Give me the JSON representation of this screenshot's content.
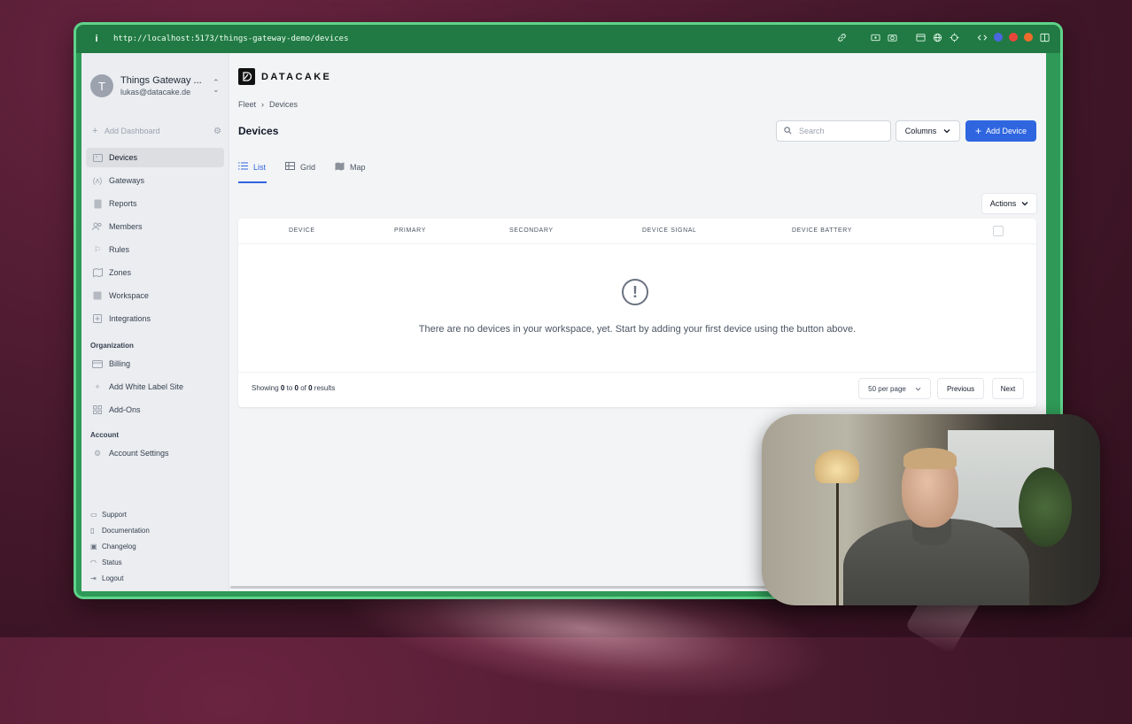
{
  "browser": {
    "info_icon": "i",
    "url": "http://localhost:5173/things-gateway-demo/devices",
    "toolbar_icons": [
      "link-icon",
      "screen-icon",
      "camera-icon",
      "window-icon",
      "globe-icon",
      "target-icon",
      "code-icon",
      "blue-extension-icon",
      "red-extension-icon",
      "orange-extension-icon",
      "sidebar-icon"
    ]
  },
  "sidebar": {
    "account": {
      "avatar_letter": "T",
      "name": "Things Gateway ...",
      "email": "lukas@datacake.de"
    },
    "add_dashboard": "Add Dashboard",
    "nav": [
      {
        "label": "Devices",
        "icon": "devices-icon",
        "active": true
      },
      {
        "label": "Gateways",
        "icon": "gateway-icon"
      },
      {
        "label": "Reports",
        "icon": "report-icon"
      },
      {
        "label": "Members",
        "icon": "members-icon"
      },
      {
        "label": "Rules",
        "icon": "rules-icon"
      },
      {
        "label": "Zones",
        "icon": "map-icon"
      },
      {
        "label": "Workspace",
        "icon": "workspace-icon"
      },
      {
        "label": "Integrations",
        "icon": "integrations-icon"
      }
    ],
    "org_label": "Organization",
    "org_nav": [
      {
        "label": "Billing",
        "icon": "billing-icon"
      },
      {
        "label": "Add White Label Site",
        "icon": "plus-icon"
      },
      {
        "label": "Add-Ons",
        "icon": "addons-icon"
      }
    ],
    "account_label": "Account",
    "account_nav": [
      {
        "label": "Account Settings",
        "icon": "gear-icon"
      }
    ],
    "footer": [
      {
        "label": "Support",
        "icon": "chat-icon"
      },
      {
        "label": "Documentation",
        "icon": "book-icon"
      },
      {
        "label": "Changelog",
        "icon": "gift-icon"
      },
      {
        "label": "Status",
        "icon": "wifi-icon"
      },
      {
        "label": "Logout",
        "icon": "logout-icon"
      }
    ]
  },
  "main": {
    "logo_text": "DATACAKE",
    "breadcrumb": [
      "Fleet",
      "Devices"
    ],
    "title": "Devices",
    "search_placeholder": "Search",
    "columns_label": "Columns",
    "add_device_label": "Add Device",
    "tabs": [
      {
        "label": "List",
        "active": true
      },
      {
        "label": "Grid"
      },
      {
        "label": "Map"
      }
    ],
    "actions_label": "Actions",
    "columns": [
      "DEVICE",
      "PRIMARY",
      "SECONDARY",
      "DEVICE SIGNAL",
      "DEVICE BATTERY"
    ],
    "empty_message": "There are no devices in your workspace, yet. Start by adding your first device using the button above.",
    "showing": {
      "prefix": "Showing",
      "from": "0",
      "to_word": "to",
      "to": "0",
      "of_word": "of",
      "total": "0",
      "suffix": "results"
    },
    "per_page": "50 per page",
    "prev_label": "Previous",
    "next_label": "Next"
  },
  "colors": {
    "window_border": "#5fd38a",
    "urlbar": "#217a43",
    "primary": "#2f66e0"
  }
}
